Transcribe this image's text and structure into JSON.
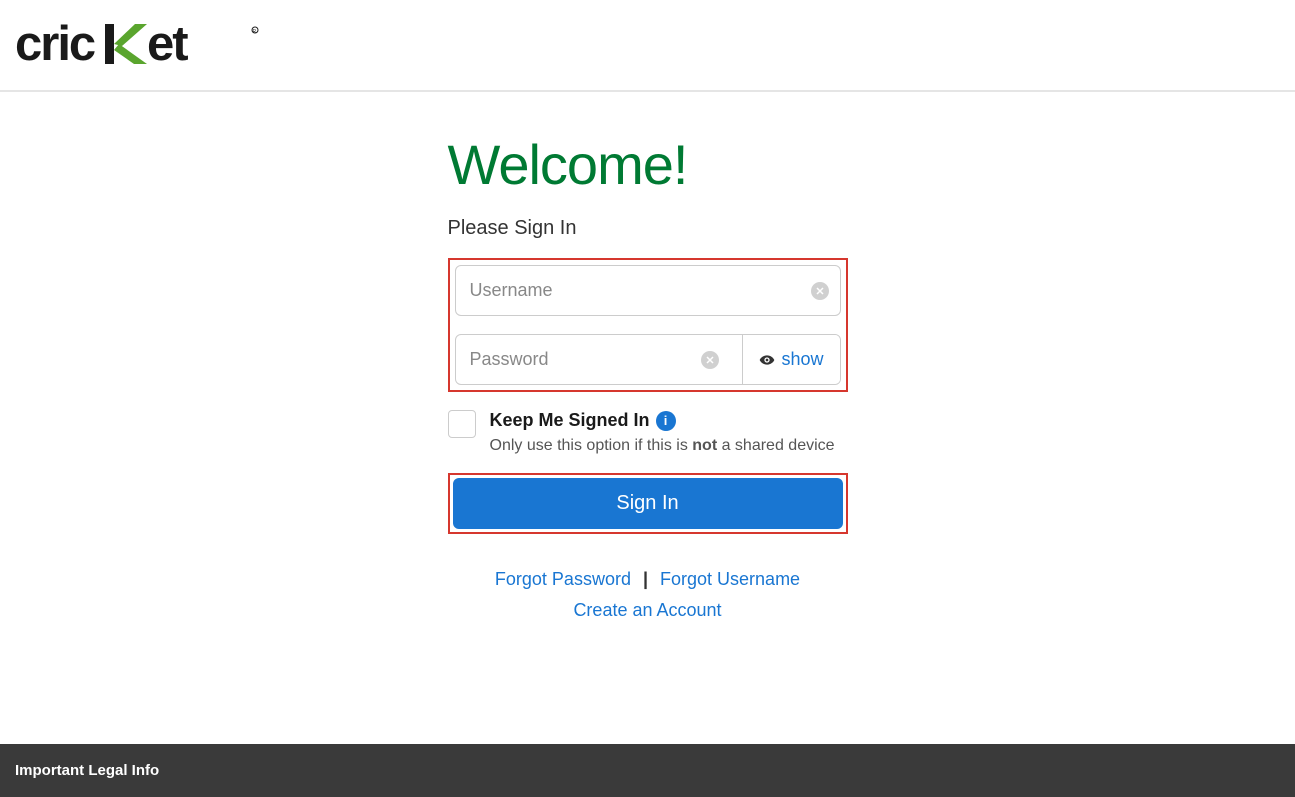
{
  "header": {
    "logo_text": "cricket"
  },
  "main": {
    "welcome_title": "Welcome!",
    "signin_label": "Please Sign In",
    "username_placeholder": "Username",
    "password_placeholder": "Password",
    "show_toggle_label": "show",
    "keep_signed_label": "Keep Me Signed In",
    "keep_signed_hint_prefix": "Only use this option if this is ",
    "keep_signed_hint_bold": "not",
    "keep_signed_hint_suffix": " a shared device",
    "signin_button_label": "Sign In",
    "forgot_password_label": "Forgot Password",
    "forgot_username_label": "Forgot Username",
    "create_account_label": "Create an Account"
  },
  "footer": {
    "legal_info_label": "Important Legal Info"
  },
  "colors": {
    "brand_green": "#007a33",
    "link_blue": "#1976d2",
    "highlight_red": "#d6372e"
  }
}
